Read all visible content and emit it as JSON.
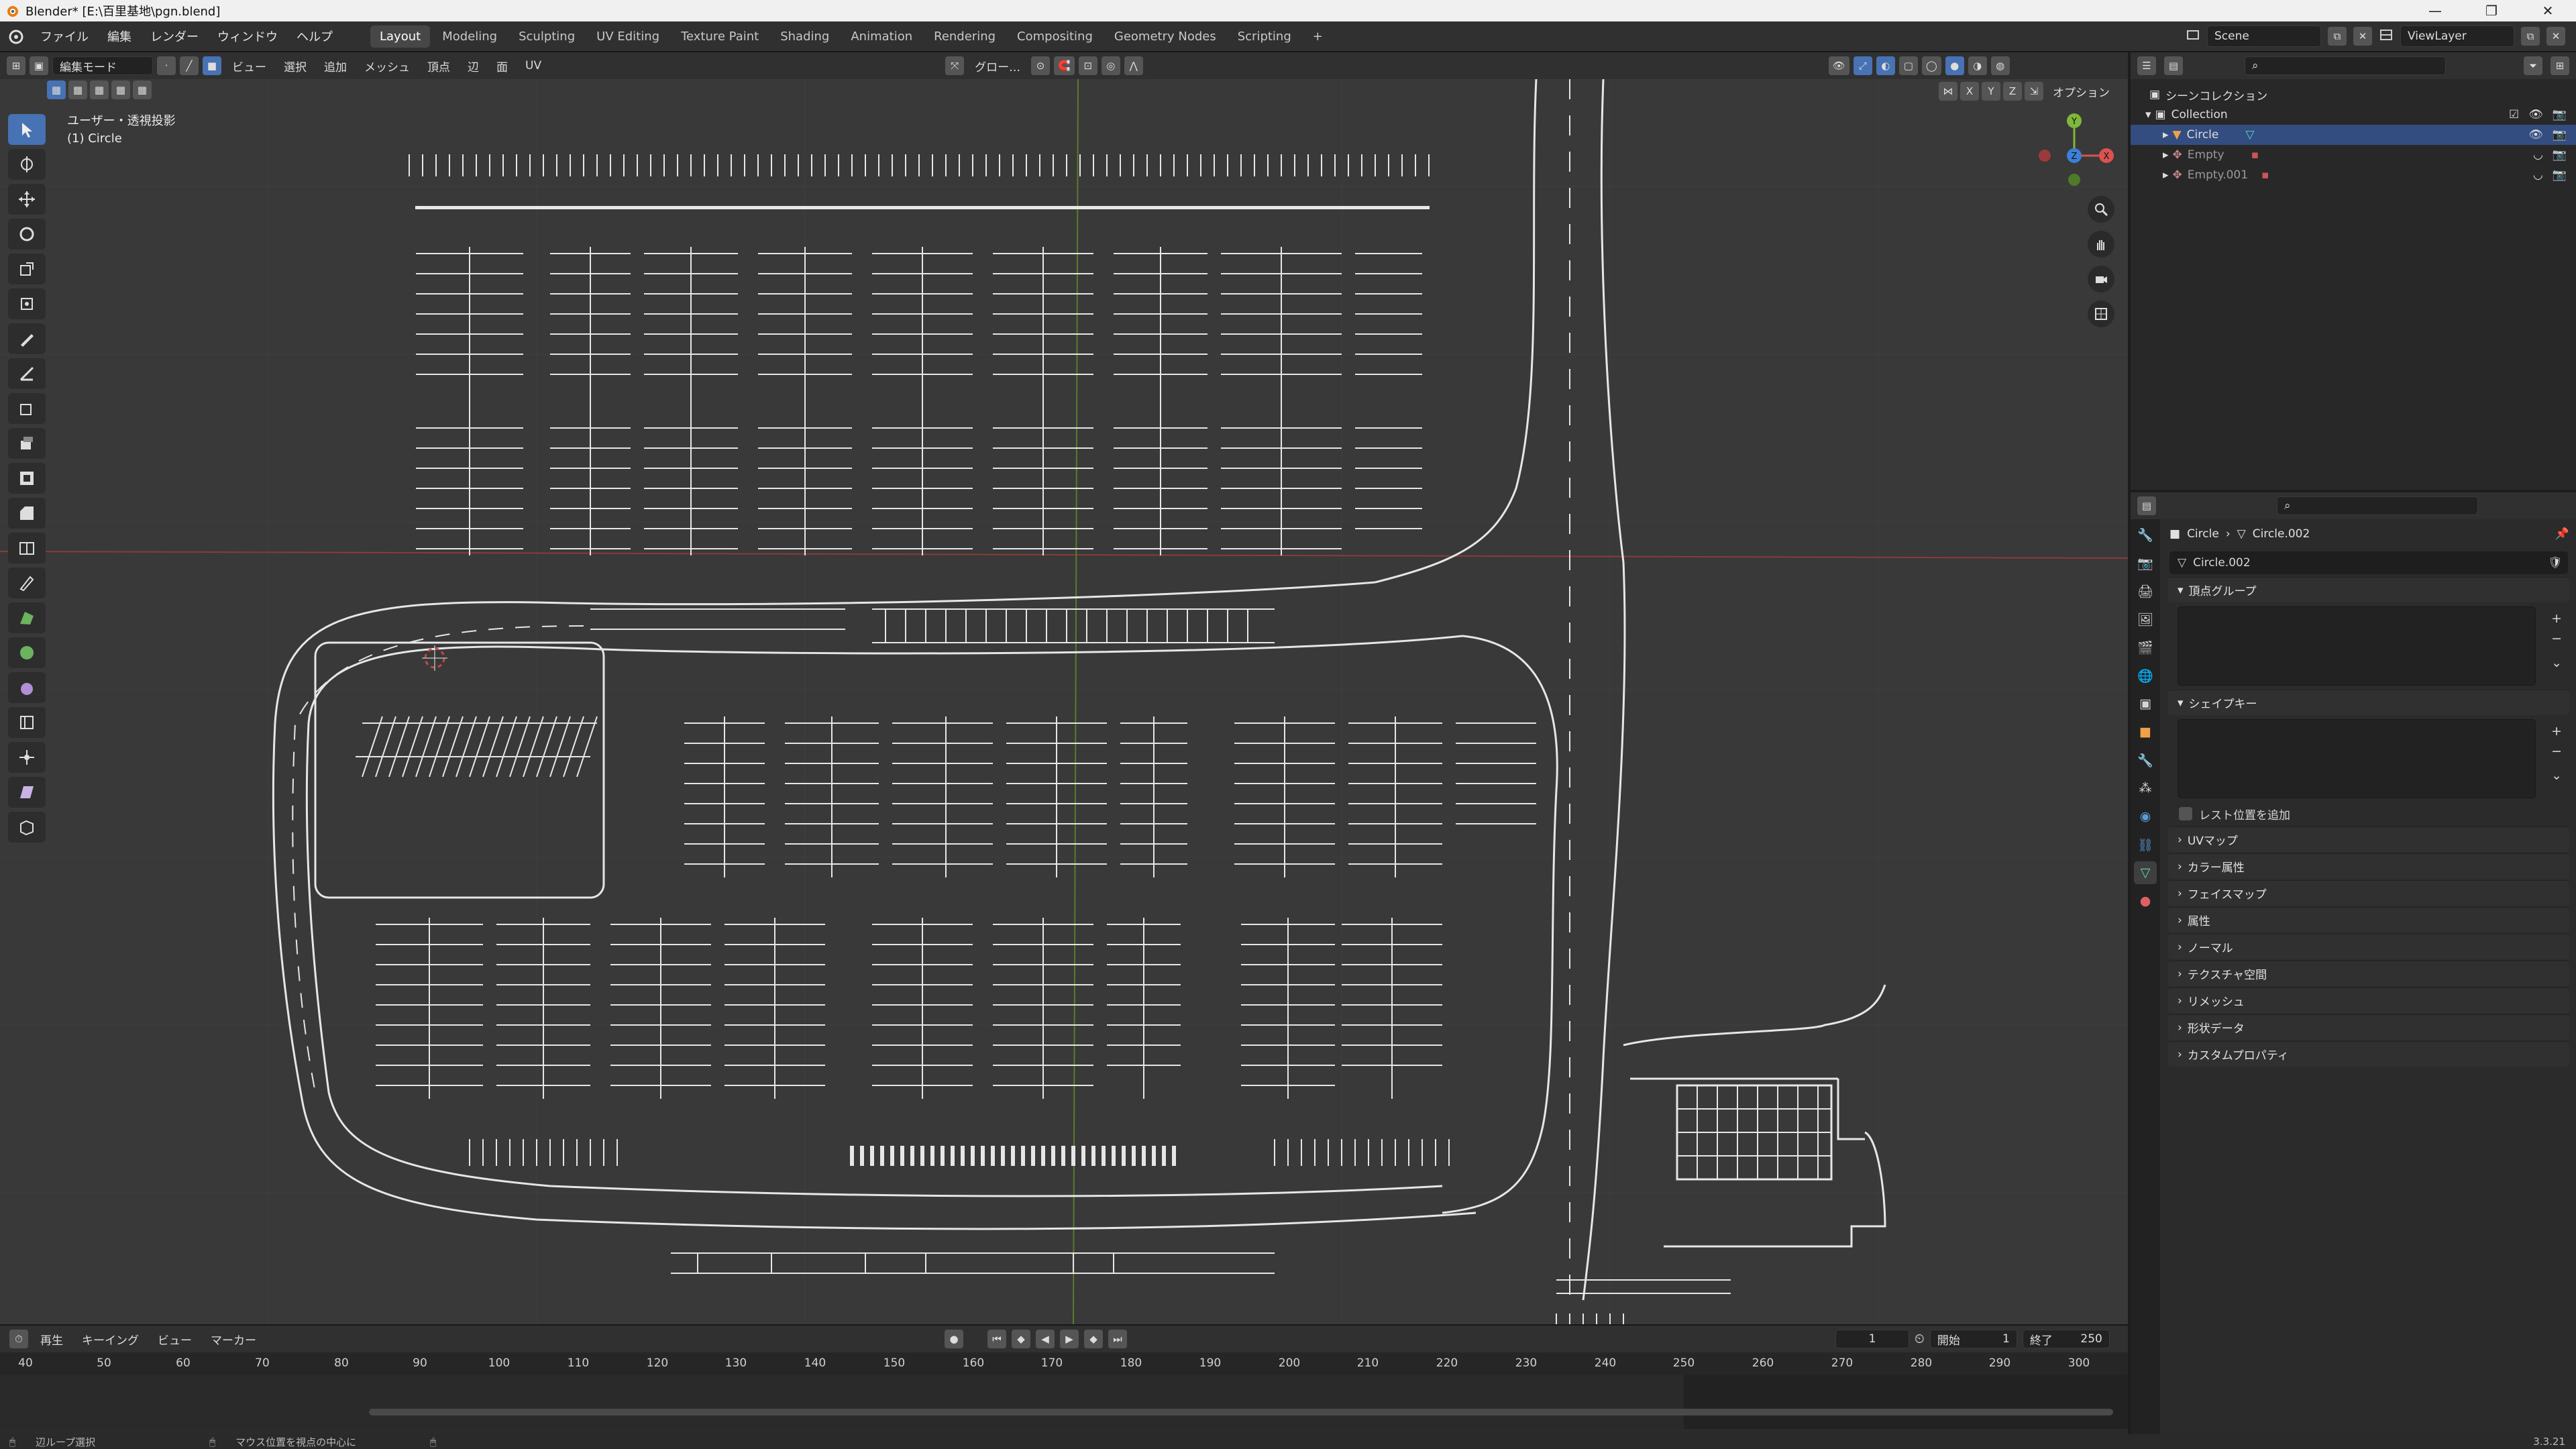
{
  "window": {
    "title": "Blender* [E:\\百里基地\\pgn.blend]",
    "controls": [
      "—",
      "❐",
      "✕"
    ]
  },
  "menubar": {
    "items": [
      "ファイル",
      "編集",
      "レンダー",
      "ウィンドウ",
      "ヘルプ"
    ],
    "workspaces": [
      "Layout",
      "Modeling",
      "Sculpting",
      "UV Editing",
      "Texture Paint",
      "Shading",
      "Animation",
      "Rendering",
      "Compositing",
      "Geometry Nodes",
      "Scripting"
    ],
    "active_workspace": "Layout",
    "add_tab": "+",
    "scene_label": "Scene",
    "viewlayer_label": "ViewLayer"
  },
  "viewport": {
    "mode": "編集モード",
    "menus": [
      "ビュー",
      "選択",
      "追加",
      "メッシュ",
      "頂点",
      "辺",
      "面",
      "UV"
    ],
    "transform": "グロー…",
    "options_label": "オプション",
    "axes": [
      "X",
      "Y",
      "Z"
    ],
    "view_name": "ユーザー・透視投影",
    "object_name": "(1) Circle"
  },
  "timeline": {
    "menus": [
      "再生",
      "キーイング",
      "ビュー",
      "マーカー"
    ],
    "current_frame": "1",
    "start_label": "開始",
    "start": "1",
    "end_label": "終了",
    "end": "250",
    "ticks": [
      "40",
      "50",
      "60",
      "70",
      "80",
      "90",
      "100",
      "110",
      "120",
      "130",
      "140",
      "150",
      "160",
      "170",
      "180",
      "190",
      "200",
      "210",
      "220",
      "230",
      "240",
      "250",
      "260",
      "270",
      "280",
      "290",
      "300"
    ]
  },
  "outliner": {
    "root": "シーンコレクション",
    "collection": "Collection",
    "items": [
      {
        "name": "Circle",
        "selected": true
      },
      {
        "name": "Empty",
        "selected": false
      },
      {
        "name": "Empty.001",
        "selected": false
      }
    ]
  },
  "properties": {
    "breadcrumb_object": "Circle",
    "breadcrumb_data": "Circle.002",
    "mesh_name": "Circle.002",
    "panels": {
      "vertex_groups": "頂点グループ",
      "shape_keys": "シェイプキー",
      "add_rest": "レスト位置を追加",
      "collapsed": [
        "UVマップ",
        "カラー属性",
        "フェイスマップ",
        "属性",
        "ノーマル",
        "テクスチャ空間",
        "リメッシュ",
        "形状データ",
        "カスタムプロパティ"
      ]
    }
  },
  "statusbar": {
    "left": "辺ループ選択",
    "middle": "マウス位置を視点の中心に",
    "version": "3.3.21"
  }
}
